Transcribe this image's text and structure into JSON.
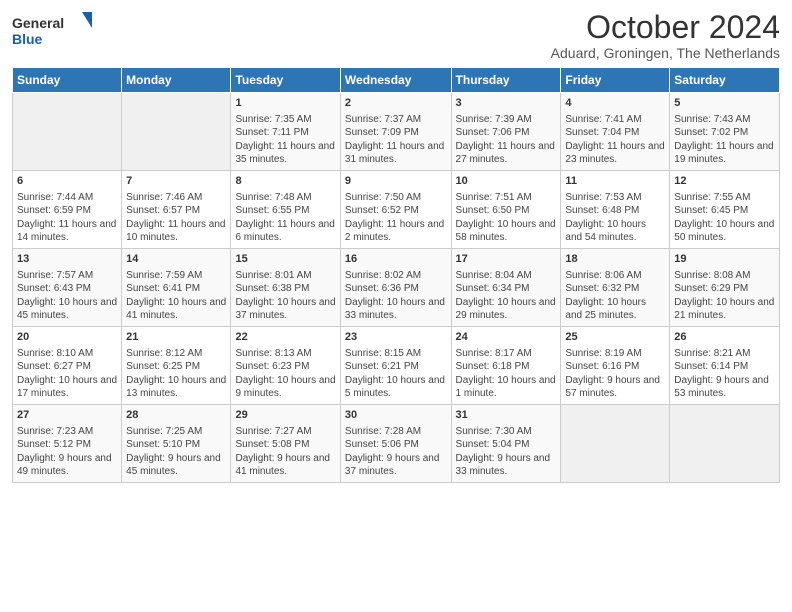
{
  "logo": {
    "line1": "General",
    "line2": "Blue"
  },
  "title": "October 2024",
  "subtitle": "Aduard, Groningen, The Netherlands",
  "days_header": [
    "Sunday",
    "Monday",
    "Tuesday",
    "Wednesday",
    "Thursday",
    "Friday",
    "Saturday"
  ],
  "weeks": [
    [
      {
        "day": "",
        "info": ""
      },
      {
        "day": "",
        "info": ""
      },
      {
        "day": "1",
        "info": "Sunrise: 7:35 AM\nSunset: 7:11 PM\nDaylight: 11 hours and 35 minutes."
      },
      {
        "day": "2",
        "info": "Sunrise: 7:37 AM\nSunset: 7:09 PM\nDaylight: 11 hours and 31 minutes."
      },
      {
        "day": "3",
        "info": "Sunrise: 7:39 AM\nSunset: 7:06 PM\nDaylight: 11 hours and 27 minutes."
      },
      {
        "day": "4",
        "info": "Sunrise: 7:41 AM\nSunset: 7:04 PM\nDaylight: 11 hours and 23 minutes."
      },
      {
        "day": "5",
        "info": "Sunrise: 7:43 AM\nSunset: 7:02 PM\nDaylight: 11 hours and 19 minutes."
      }
    ],
    [
      {
        "day": "6",
        "info": "Sunrise: 7:44 AM\nSunset: 6:59 PM\nDaylight: 11 hours and 14 minutes."
      },
      {
        "day": "7",
        "info": "Sunrise: 7:46 AM\nSunset: 6:57 PM\nDaylight: 11 hours and 10 minutes."
      },
      {
        "day": "8",
        "info": "Sunrise: 7:48 AM\nSunset: 6:55 PM\nDaylight: 11 hours and 6 minutes."
      },
      {
        "day": "9",
        "info": "Sunrise: 7:50 AM\nSunset: 6:52 PM\nDaylight: 11 hours and 2 minutes."
      },
      {
        "day": "10",
        "info": "Sunrise: 7:51 AM\nSunset: 6:50 PM\nDaylight: 10 hours and 58 minutes."
      },
      {
        "day": "11",
        "info": "Sunrise: 7:53 AM\nSunset: 6:48 PM\nDaylight: 10 hours and 54 minutes."
      },
      {
        "day": "12",
        "info": "Sunrise: 7:55 AM\nSunset: 6:45 PM\nDaylight: 10 hours and 50 minutes."
      }
    ],
    [
      {
        "day": "13",
        "info": "Sunrise: 7:57 AM\nSunset: 6:43 PM\nDaylight: 10 hours and 45 minutes."
      },
      {
        "day": "14",
        "info": "Sunrise: 7:59 AM\nSunset: 6:41 PM\nDaylight: 10 hours and 41 minutes."
      },
      {
        "day": "15",
        "info": "Sunrise: 8:01 AM\nSunset: 6:38 PM\nDaylight: 10 hours and 37 minutes."
      },
      {
        "day": "16",
        "info": "Sunrise: 8:02 AM\nSunset: 6:36 PM\nDaylight: 10 hours and 33 minutes."
      },
      {
        "day": "17",
        "info": "Sunrise: 8:04 AM\nSunset: 6:34 PM\nDaylight: 10 hours and 29 minutes."
      },
      {
        "day": "18",
        "info": "Sunrise: 8:06 AM\nSunset: 6:32 PM\nDaylight: 10 hours and 25 minutes."
      },
      {
        "day": "19",
        "info": "Sunrise: 8:08 AM\nSunset: 6:29 PM\nDaylight: 10 hours and 21 minutes."
      }
    ],
    [
      {
        "day": "20",
        "info": "Sunrise: 8:10 AM\nSunset: 6:27 PM\nDaylight: 10 hours and 17 minutes."
      },
      {
        "day": "21",
        "info": "Sunrise: 8:12 AM\nSunset: 6:25 PM\nDaylight: 10 hours and 13 minutes."
      },
      {
        "day": "22",
        "info": "Sunrise: 8:13 AM\nSunset: 6:23 PM\nDaylight: 10 hours and 9 minutes."
      },
      {
        "day": "23",
        "info": "Sunrise: 8:15 AM\nSunset: 6:21 PM\nDaylight: 10 hours and 5 minutes."
      },
      {
        "day": "24",
        "info": "Sunrise: 8:17 AM\nSunset: 6:18 PM\nDaylight: 10 hours and 1 minute."
      },
      {
        "day": "25",
        "info": "Sunrise: 8:19 AM\nSunset: 6:16 PM\nDaylight: 9 hours and 57 minutes."
      },
      {
        "day": "26",
        "info": "Sunrise: 8:21 AM\nSunset: 6:14 PM\nDaylight: 9 hours and 53 minutes."
      }
    ],
    [
      {
        "day": "27",
        "info": "Sunrise: 7:23 AM\nSunset: 5:12 PM\nDaylight: 9 hours and 49 minutes."
      },
      {
        "day": "28",
        "info": "Sunrise: 7:25 AM\nSunset: 5:10 PM\nDaylight: 9 hours and 45 minutes."
      },
      {
        "day": "29",
        "info": "Sunrise: 7:27 AM\nSunset: 5:08 PM\nDaylight: 9 hours and 41 minutes."
      },
      {
        "day": "30",
        "info": "Sunrise: 7:28 AM\nSunset: 5:06 PM\nDaylight: 9 hours and 37 minutes."
      },
      {
        "day": "31",
        "info": "Sunrise: 7:30 AM\nSunset: 5:04 PM\nDaylight: 9 hours and 33 minutes."
      },
      {
        "day": "",
        "info": ""
      },
      {
        "day": "",
        "info": ""
      }
    ]
  ]
}
